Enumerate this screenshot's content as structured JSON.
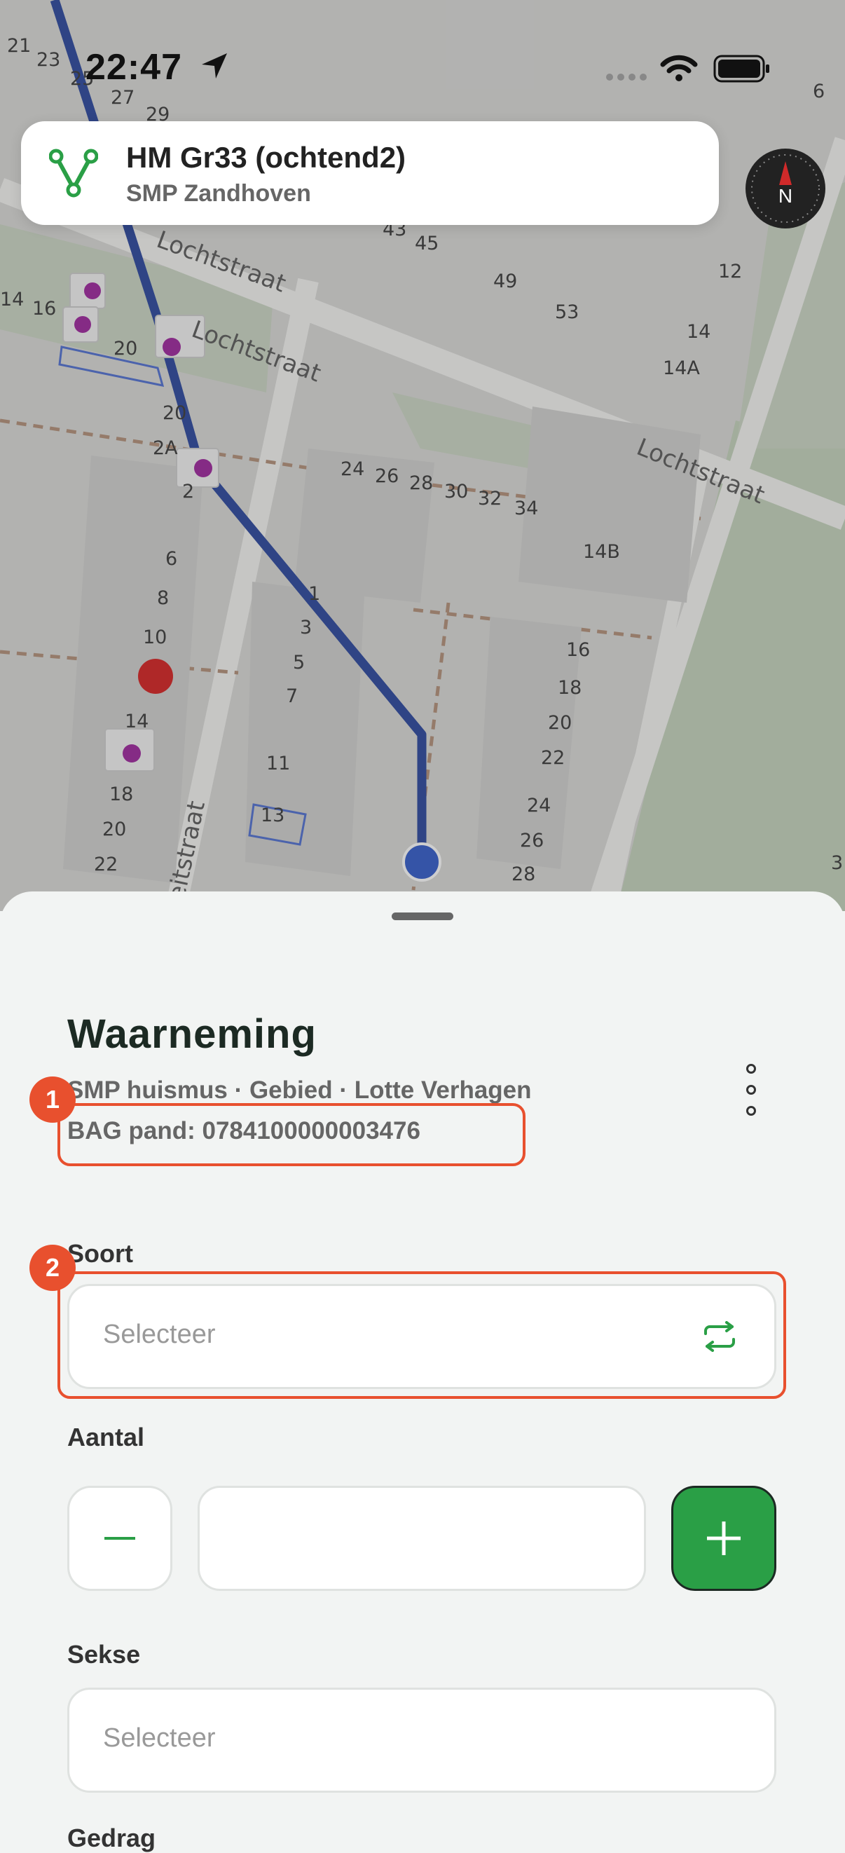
{
  "status": {
    "time": "22:47"
  },
  "route": {
    "title": "HM Gr33 (ochtend2)",
    "subtitle": "SMP Zandhoven"
  },
  "compass": {
    "letter": "N"
  },
  "map": {
    "streets": [
      "Lochtstraat",
      "Lochtstraat",
      "Lochtstraat",
      "eitstraat"
    ],
    "numbers": [
      "21",
      "23",
      "25",
      "27",
      "29",
      "6",
      "43",
      "45",
      "49",
      "53",
      "12",
      "14",
      "14A",
      "14",
      "16",
      "20",
      "20",
      "2A",
      "2",
      "24",
      "26",
      "28",
      "30",
      "32",
      "34",
      "14B",
      "6",
      "8",
      "10",
      "1",
      "3",
      "5",
      "7",
      "16",
      "18",
      "20",
      "22",
      "14",
      "11",
      "18",
      "13",
      "20",
      "22",
      "24",
      "26",
      "28",
      "3"
    ]
  },
  "sheet": {
    "title": "Waarneming",
    "meta": "SMP huismus · Gebied · Lotte Verhagen",
    "bag": "BAG pand: 0784100000003476",
    "badges": [
      "1",
      "2"
    ],
    "soort": {
      "label": "Soort",
      "placeholder": "Selecteer"
    },
    "aantal": {
      "label": "Aantal",
      "value": ""
    },
    "sekse": {
      "label": "Sekse",
      "placeholder": "Selecteer"
    },
    "gedrag": {
      "label": "Gedrag"
    }
  },
  "colors": {
    "accent": "#2a9f46",
    "highlight": "#e8502e",
    "route": "#23409a"
  }
}
